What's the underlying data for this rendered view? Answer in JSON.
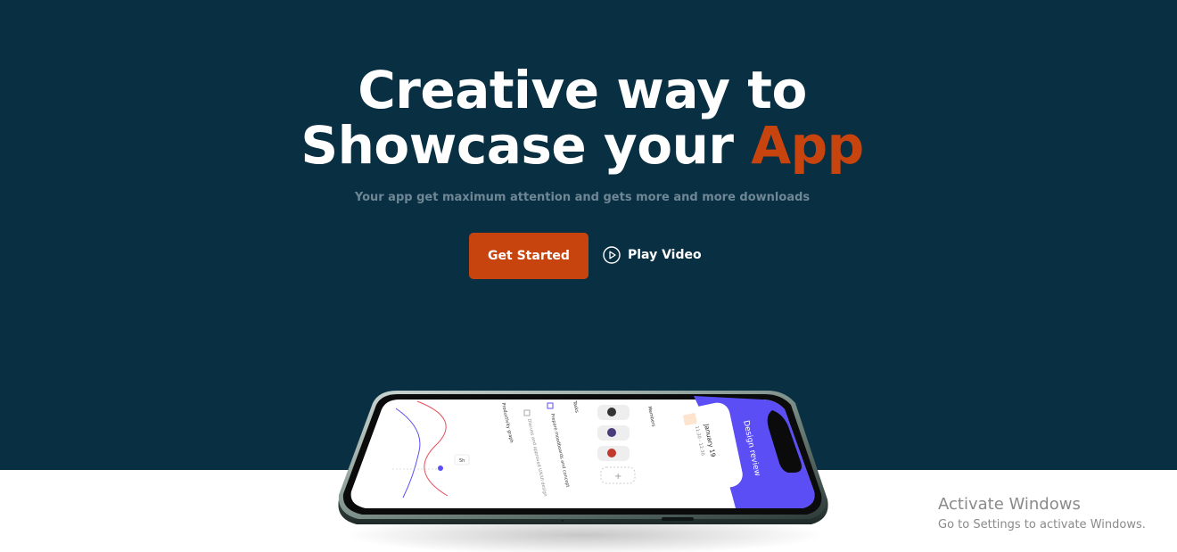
{
  "hero": {
    "headline_line1": "Creative way to",
    "headline_line2_prefix": "Showcase your",
    "headline_accent": "App",
    "subtitle": "Your app get maximum attention and gets more and more downloads",
    "primary_button": "Get Started",
    "video_button": "Play Video"
  },
  "phone_screen": {
    "members_label": "Members",
    "tasks_label": "Tasks",
    "task_1": "Prepare moodboards and concept",
    "task_2": "Discuss and approved UX/UI design",
    "graph_label": "Productivity graph",
    "graph_badge": "5h",
    "event_title": "Design review",
    "event_date": "January 19",
    "event_time": "11:30 - 12:30"
  },
  "watermark": {
    "title": "Activate Windows",
    "subtitle": "Go to Settings to activate Windows."
  },
  "colors": {
    "hero_background": "#092f42",
    "accent": "#c8440f",
    "subtitle": "#6f8795",
    "phone_accent": "#5b4ef5"
  },
  "icons": {
    "play": "play-circle-icon",
    "phone": "smartphone-mockup"
  }
}
